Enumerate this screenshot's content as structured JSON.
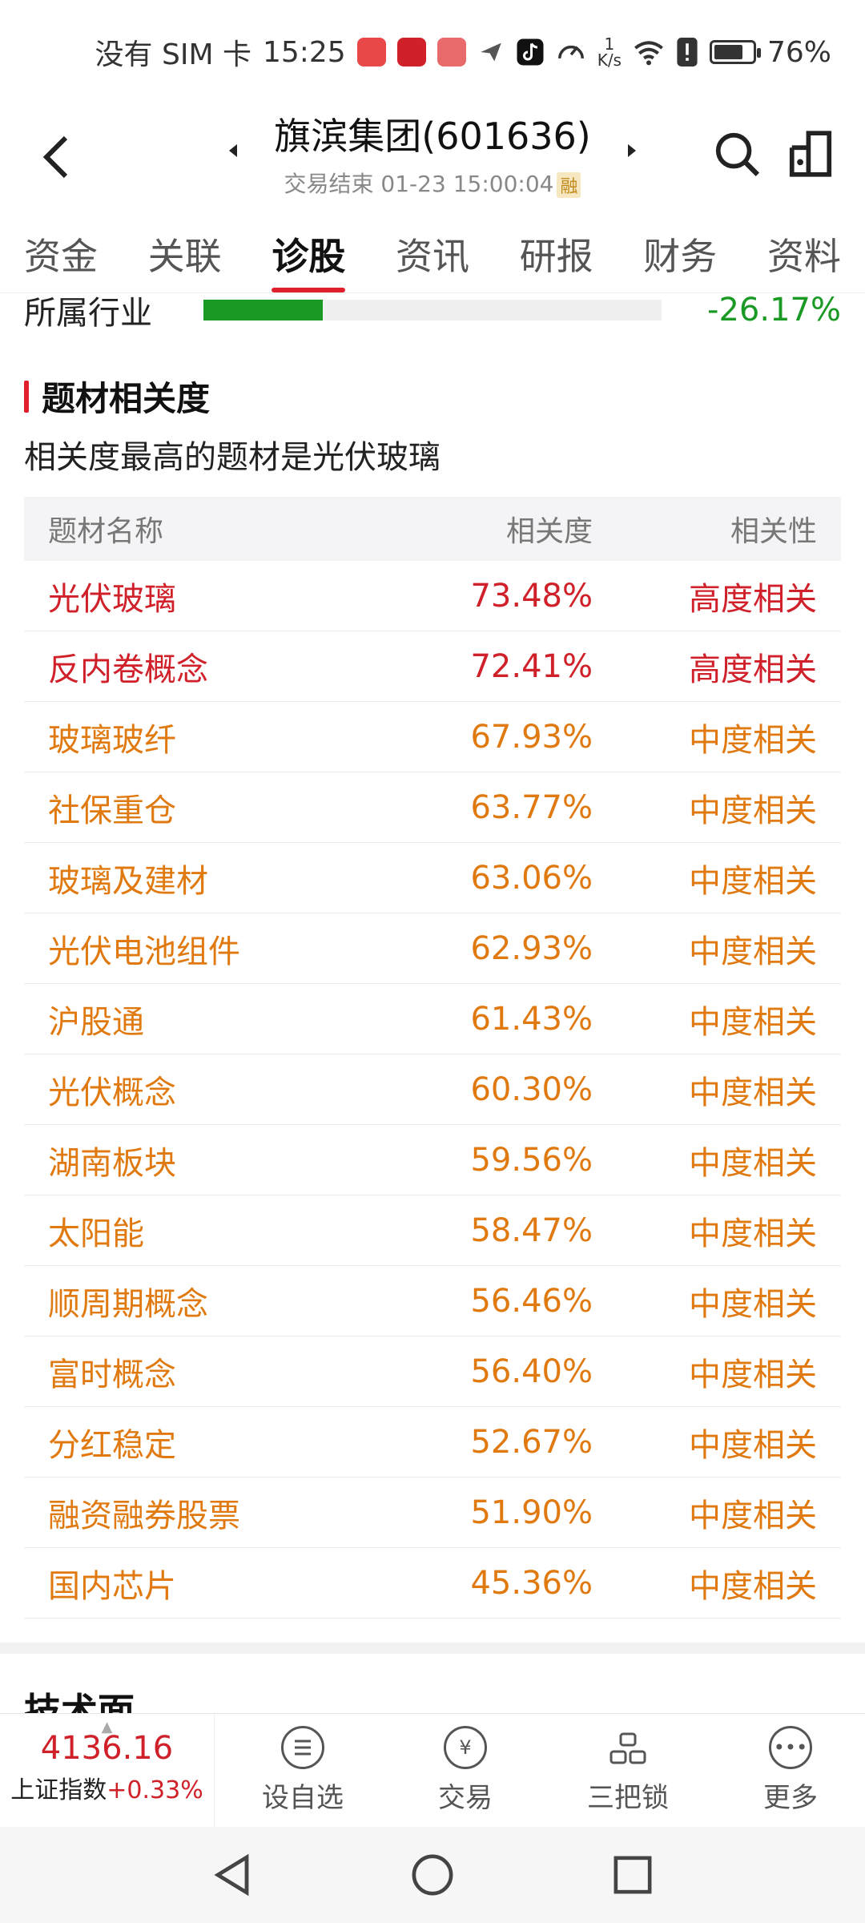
{
  "status_bar": {
    "carrier": "没有 SIM 卡",
    "time": "15:25",
    "speed_top": "1",
    "speed_bottom": "K/s",
    "battery": "76%",
    "battery_level": 0.76,
    "icons": [
      "huawei-app-icon",
      "wanlian-app-icon",
      "mail-app-icon",
      "paper-plane-icon",
      "tiktok-icon",
      "speed-gauge-icon",
      "wifi-icon",
      "alert-icon",
      "battery-icon"
    ]
  },
  "header": {
    "title": "旗滨集团(601636)",
    "subtitle": "交易结束 01-23 15:00:04",
    "badge": "融"
  },
  "tabs": [
    {
      "label": "资金",
      "active": false
    },
    {
      "label": "关联",
      "active": false
    },
    {
      "label": "诊股",
      "active": true
    },
    {
      "label": "资讯",
      "active": false
    },
    {
      "label": "研报",
      "active": false
    },
    {
      "label": "财务",
      "active": false
    },
    {
      "label": "资料",
      "active": false
    }
  ],
  "industry": {
    "label": "所属行业",
    "pct": "-26.17%",
    "bar_level": 0.26
  },
  "section": {
    "title": "题材相关度",
    "desc": "相关度最高的题材是光伏玻璃"
  },
  "table": {
    "headers": {
      "name": "题材名称",
      "pct": "相关度",
      "rel": "相关性"
    },
    "rows": [
      {
        "name": "光伏玻璃",
        "pct": "73.48%",
        "rel": "高度相关",
        "level": "high"
      },
      {
        "name": "反内卷概念",
        "pct": "72.41%",
        "rel": "高度相关",
        "level": "high"
      },
      {
        "name": "玻璃玻纤",
        "pct": "67.93%",
        "rel": "中度相关",
        "level": "mid"
      },
      {
        "name": "社保重仓",
        "pct": "63.77%",
        "rel": "中度相关",
        "level": "mid"
      },
      {
        "name": "玻璃及建材",
        "pct": "63.06%",
        "rel": "中度相关",
        "level": "mid"
      },
      {
        "name": "光伏电池组件",
        "pct": "62.93%",
        "rel": "中度相关",
        "level": "mid"
      },
      {
        "name": "沪股通",
        "pct": "61.43%",
        "rel": "中度相关",
        "level": "mid"
      },
      {
        "name": "光伏概念",
        "pct": "60.30%",
        "rel": "中度相关",
        "level": "mid"
      },
      {
        "name": "湖南板块",
        "pct": "59.56%",
        "rel": "中度相关",
        "level": "mid"
      },
      {
        "name": "太阳能",
        "pct": "58.47%",
        "rel": "中度相关",
        "level": "mid"
      },
      {
        "name": "顺周期概念",
        "pct": "56.46%",
        "rel": "中度相关",
        "level": "mid"
      },
      {
        "name": "富时概念",
        "pct": "56.40%",
        "rel": "中度相关",
        "level": "mid"
      },
      {
        "name": "分红稳定",
        "pct": "52.67%",
        "rel": "中度相关",
        "level": "mid"
      },
      {
        "name": "融资融券股票",
        "pct": "51.90%",
        "rel": "中度相关",
        "level": "mid"
      },
      {
        "name": "国内芯片",
        "pct": "45.36%",
        "rel": "中度相关",
        "level": "mid"
      }
    ]
  },
  "tech": {
    "title": "技术面"
  },
  "bottom_bar": {
    "index_value": "4136.16",
    "index_name": "上证指数",
    "index_change": "+0.33%",
    "nav": [
      {
        "label": "设自选",
        "icon": "menu-list-icon"
      },
      {
        "label": "交易",
        "icon": "yen-refresh-icon"
      },
      {
        "label": "三把锁",
        "icon": "locks-icon"
      },
      {
        "label": "更多",
        "icon": "more-dots-icon"
      }
    ]
  },
  "colors": {
    "accent_red": "#e0202c",
    "high_text": "#d0202a",
    "mid_text": "#e07a10",
    "green": "#1a9a25"
  }
}
